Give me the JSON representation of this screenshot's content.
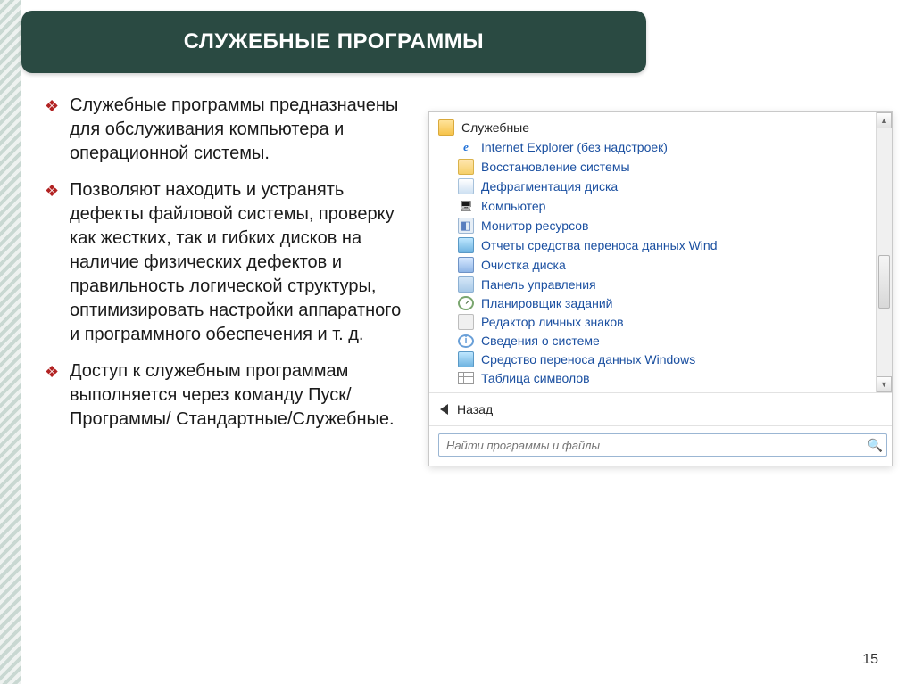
{
  "title": "СЛУЖЕБНЫЕ ПРОГРАММЫ",
  "bullets": [
    "Служебные программы предназначены для обслуживания компьютера и операционной системы.",
    "Позволяют находить и устранять дефекты файловой системы, проверку как жестких, так и гибких дисков на наличие физических дефектов и правильность логической структуры, оптимизировать настройки аппаратного и программного обеспечения и т. д.",
    "Доступ к служебным программам выполняется через команду Пуск/Программы/ Стандартные/Служебные."
  ],
  "menu": {
    "folder_name": "Служебные",
    "items": [
      {
        "icon": "ie-ico",
        "label": "Internet Explorer (без надстроек)"
      },
      {
        "icon": "restore-ico",
        "label": "Восстановление системы"
      },
      {
        "icon": "defrag-ico",
        "label": "Дефрагментация диска"
      },
      {
        "icon": "comp-ico",
        "label": "Компьютер"
      },
      {
        "icon": "chart-ico",
        "label": "Монитор ресурсов"
      },
      {
        "icon": "transfer-ico",
        "label": "Отчеты средства переноса данных Wind"
      },
      {
        "icon": "disk-ico",
        "label": "Очистка диска"
      },
      {
        "icon": "panel-ico",
        "label": "Панель управления"
      },
      {
        "icon": "clock-ico",
        "label": "Планировщик заданий"
      },
      {
        "icon": "editor-ico",
        "label": "Редактор личных знаков"
      },
      {
        "icon": "info-ico",
        "label": "Сведения о системе"
      },
      {
        "icon": "transfer-ico",
        "label": "Средство переноса данных Windows"
      },
      {
        "icon": "table-ico",
        "label": "Таблица символов"
      }
    ],
    "back_label": "Назад",
    "search_placeholder": "Найти программы и файлы"
  },
  "page_number": "15"
}
